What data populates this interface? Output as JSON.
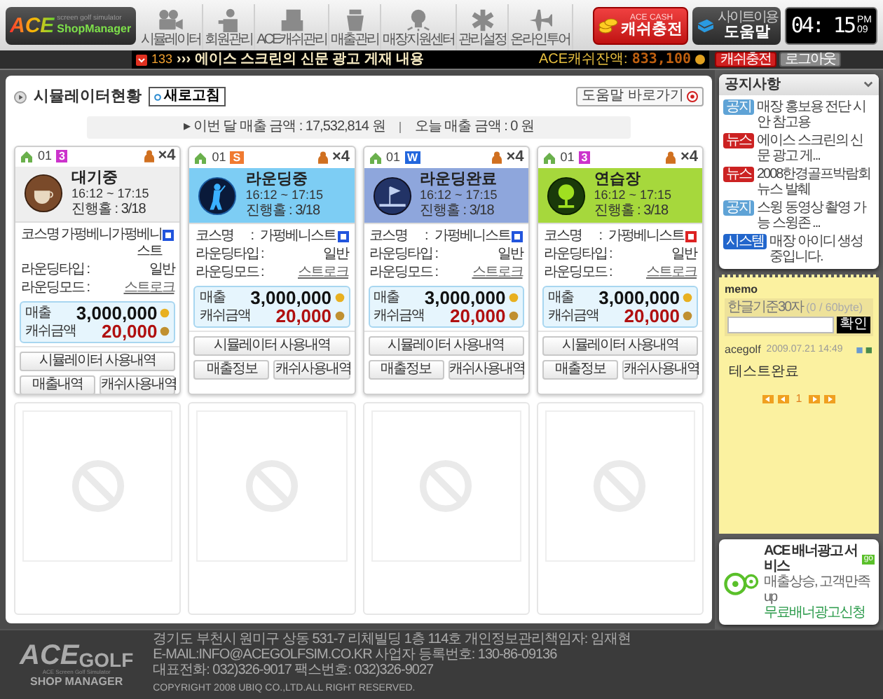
{
  "header": {
    "logo": {
      "brand": "ACE",
      "subtitle": "screen golf simulator",
      "product": "ShopManager"
    },
    "nav": [
      {
        "label": "시뮬레이터"
      },
      {
        "label": "회원관리"
      },
      {
        "label": "ACE캐쉬관리"
      },
      {
        "label": "매출관리"
      },
      {
        "label": "매장지원센터"
      },
      {
        "label": "관리설정"
      },
      {
        "label": "온라인투어"
      }
    ],
    "cash_button": {
      "caption": "ACE CASH",
      "label": "캐쉬충전"
    },
    "help_button": {
      "caption": "사이트이용",
      "label": "도움말"
    },
    "clock": {
      "time": "04: 15",
      "meridiem": "PM",
      "day": "09"
    }
  },
  "ticker": {
    "count": "133",
    "headline": "››› 에이스 스크린의 신문 광고 게재 내용",
    "balance_label": "ACE캐쉬잔액:",
    "balance": "833,100",
    "buttons": [
      "캐쉬충전",
      "로그아웃"
    ]
  },
  "panel": {
    "title": "시뮬레이터현황",
    "refresh": "새로고침",
    "help_link": "도움말 바로가기",
    "summary": [
      "▸ 이번 달 매출 금액 : 17,532,814 원",
      "오늘 매출 금액 : 0 원"
    ]
  },
  "simulators": [
    {
      "kind": "waiting",
      "room": "01",
      "badge": {
        "text": "3",
        "color": "#cc33cc"
      },
      "players": "×4",
      "status": "대기중",
      "time": "16:12 ~ 17:15",
      "progress": "진행홀 : 3/18",
      "course_label": "코스명",
      "course": "가펑베니가펑베니스트",
      "course_tag": {
        "color": "#2255dd"
      },
      "round_type_label": "라운딩타입 :",
      "round_type": "일반",
      "round_mode_label": "라운딩모드 :",
      "round_mode": "스트로크",
      "sales_label": "매출",
      "sales": "3,000,000",
      "cash_label": "캐쉬금액",
      "cash": "20,000",
      "buttons": [
        "시뮬레이터 사용내역",
        "매출내역",
        "캐쉬사용내역"
      ]
    },
    {
      "kind": "rounding",
      "room": "01",
      "badge": {
        "text": "S",
        "color": "#f07a30"
      },
      "players": "×4",
      "status": "라운딩중",
      "time": "16:12 ~ 17:15",
      "progress": "진행홀 : 3/18",
      "course_label": "코스명       :",
      "course": "가펑베니스트",
      "course_tag": {
        "color": "#2255dd"
      },
      "round_type_label": "라운딩타입 :",
      "round_type": "일반",
      "round_mode_label": "라운딩모드 :",
      "round_mode": "스트로크",
      "sales_label": "매출",
      "sales": "3,000,000",
      "cash_label": "캐쉬금액",
      "cash": "20,000",
      "buttons": [
        "시뮬레이터 사용내역",
        "매출정보",
        "캐쉬사용내역"
      ]
    },
    {
      "kind": "done",
      "room": "01",
      "badge": {
        "text": "W",
        "color": "#2266dd"
      },
      "players": "×4",
      "status": "라운딩완료",
      "time": "16:12 ~ 17:15",
      "progress": "진행홀 : 3/18",
      "course_label": "코스명       :",
      "course": "가펑베니스트",
      "course_tag": {
        "color": "#2255dd"
      },
      "round_type_label": "라운딩타입 :",
      "round_type": "일반",
      "round_mode_label": "라운딩모드 :",
      "round_mode": "스트로크",
      "sales_label": "매출",
      "sales": "3,000,000",
      "cash_label": "캐쉬금액",
      "cash": "20,000",
      "buttons": [
        "시뮬레이터 사용내역",
        "매출정보",
        "캐쉬사용내역"
      ]
    },
    {
      "kind": "practice",
      "room": "01",
      "badge": {
        "text": "3",
        "color": "#cc33cc"
      },
      "players": "×4",
      "status": "연습장",
      "time": "16:12 ~ 17:15",
      "progress": "진행홀 : 3/18",
      "course_label": "코스명       :",
      "course": "가펑베니스트",
      "course_tag": {
        "color": "#dd2222"
      },
      "round_type_label": "라운딩타입 :",
      "round_type": "일반",
      "round_mode_label": "라운딩모드 :",
      "round_mode": "스트로크",
      "sales_label": "매출",
      "sales": "3,000,000",
      "cash_label": "캐쉬금액",
      "cash": "20,000",
      "buttons": [
        "시뮬레이터 사용내역",
        "매출정보",
        "캐쉬사용내역"
      ]
    },
    {
      "kind": "empty"
    },
    {
      "kind": "empty"
    },
    {
      "kind": "empty"
    },
    {
      "kind": "empty"
    }
  ],
  "notices": {
    "title": "공지사항",
    "items": [
      {
        "tag": {
          "text": "공지",
          "color": "#5fa3d6"
        },
        "text": "매장 홍보용 전단 시안 참고용"
      },
      {
        "tag": {
          "text": "뉴스",
          "color": "#cc2222"
        },
        "text": "에이스 스크린의 신문 광고 게..."
      },
      {
        "tag": {
          "text": "뉴스",
          "color": "#cc2222"
        },
        "text": "2008한경골프박람회 뉴스 발췌"
      },
      {
        "tag": {
          "text": "공지",
          "color": "#5fa3d6"
        },
        "text": "스윙 동영상 촬영 가능 스윙존 ..."
      },
      {
        "tag": {
          "text": "시스템",
          "color": "#2266cc"
        },
        "text": "매장 아이디 생성 중입니다."
      }
    ]
  },
  "memo": {
    "title": "memo",
    "hint": "한글기준30자",
    "counter": "(0 / 60byte)",
    "button": "확인",
    "author": "acegolf",
    "date": "2009.07.21 14:49",
    "text": "테스트완료",
    "page": "1"
  },
  "banner": {
    "title": "ACE 배너광고 서비스",
    "badge": "go",
    "line": "매출상승, 고객만족up",
    "link": "무료배너광고신청"
  },
  "footer": {
    "brand": "ACE",
    "brand_suffix": "GOLF",
    "tagline": "ACE Screen Golf Simulator",
    "product": "SHOP MANAGER",
    "lines": [
      "경기도 부천시 원미구 상동 531-7 리체빌딩 1층 114호 개인정보관리책임자: 임재현",
      "E-MAIL:INFO@ACEGOLFSIM.CO.KR 사업자 등록번호: 130-86-09136",
      "대표전화: 032)326-9017 팩스번호: 032)326-9027",
      "COPYRIGHT 2008 UBIQ CO.,LTD.ALL RIGHT RESERVED."
    ]
  }
}
